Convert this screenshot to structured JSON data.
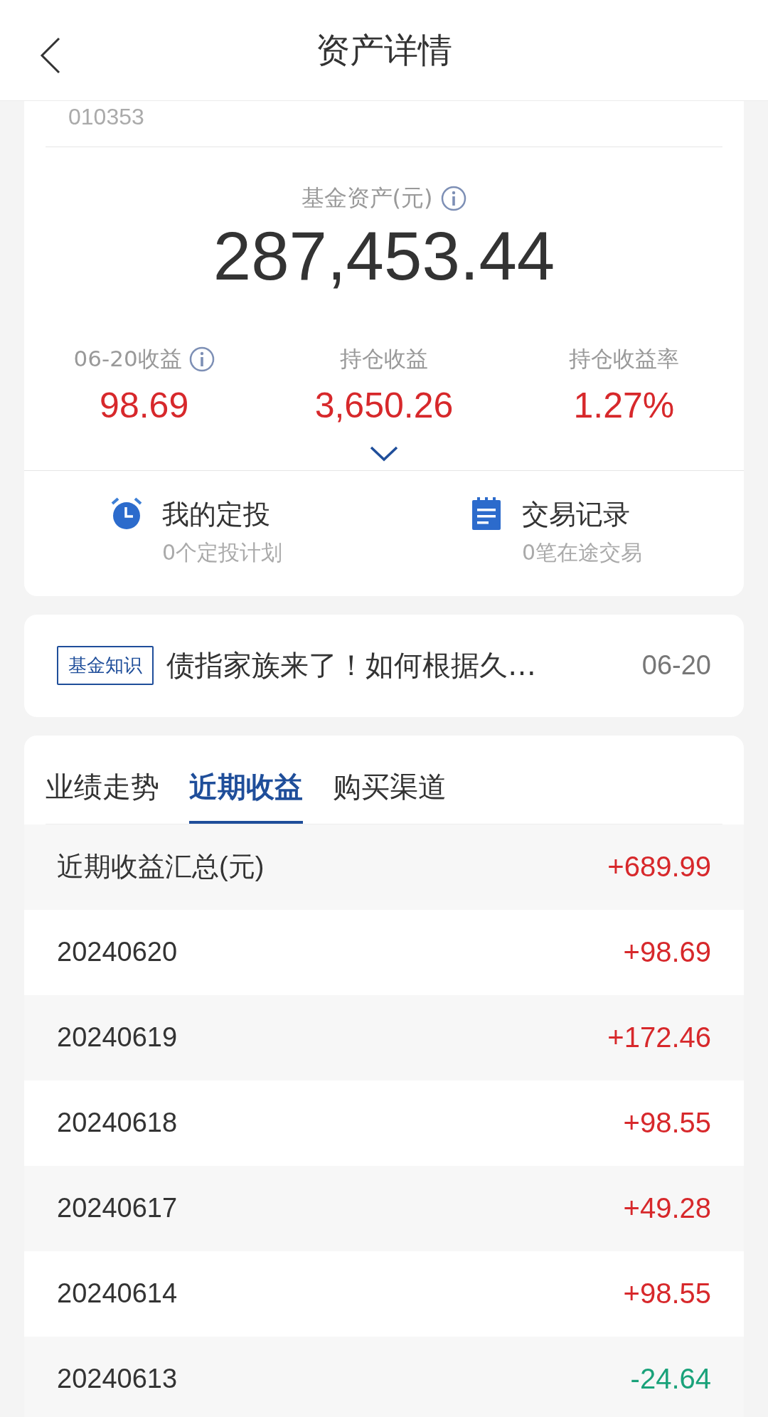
{
  "header": {
    "title": "资产详情"
  },
  "fund": {
    "code": "010353",
    "asset_label": "基金资产(元)",
    "asset_value": "287,453.44",
    "stats": [
      {
        "label": "06-20收益",
        "value": "98.69",
        "info": true
      },
      {
        "label": "持仓收益",
        "value": "3,650.26",
        "info": false
      },
      {
        "label": "持仓收益率",
        "value": "1.27%",
        "info": false
      }
    ]
  },
  "shortcuts": [
    {
      "kind": "clock",
      "title": "我的定投",
      "subtitle": "0个定投计划"
    },
    {
      "kind": "notepad",
      "title": "交易记录",
      "subtitle": "0笔在途交易"
    }
  ],
  "news": {
    "tag": "基金知识",
    "headline": "债指家族来了！如何根据久…",
    "date": "06-20"
  },
  "tabs": [
    {
      "label": "业绩走势",
      "selected": false
    },
    {
      "label": "近期收益",
      "selected": true
    },
    {
      "label": "购买渠道",
      "selected": false
    }
  ],
  "earnings": [
    {
      "date": "近期收益汇总(元)",
      "value": "+689.99",
      "color": "#d7282b"
    },
    {
      "date": "20240620",
      "value": "+98.69",
      "color": "#d7282b"
    },
    {
      "date": "20240619",
      "value": "+172.46",
      "color": "#d7282b"
    },
    {
      "date": "20240618",
      "value": "+98.55",
      "color": "#d7282b"
    },
    {
      "date": "20240617",
      "value": "+49.28",
      "color": "#d7282b"
    },
    {
      "date": "20240614",
      "value": "+98.55",
      "color": "#d7282b"
    },
    {
      "date": "20240613",
      "value": "-24.64",
      "color": "#1aa27a"
    }
  ]
}
